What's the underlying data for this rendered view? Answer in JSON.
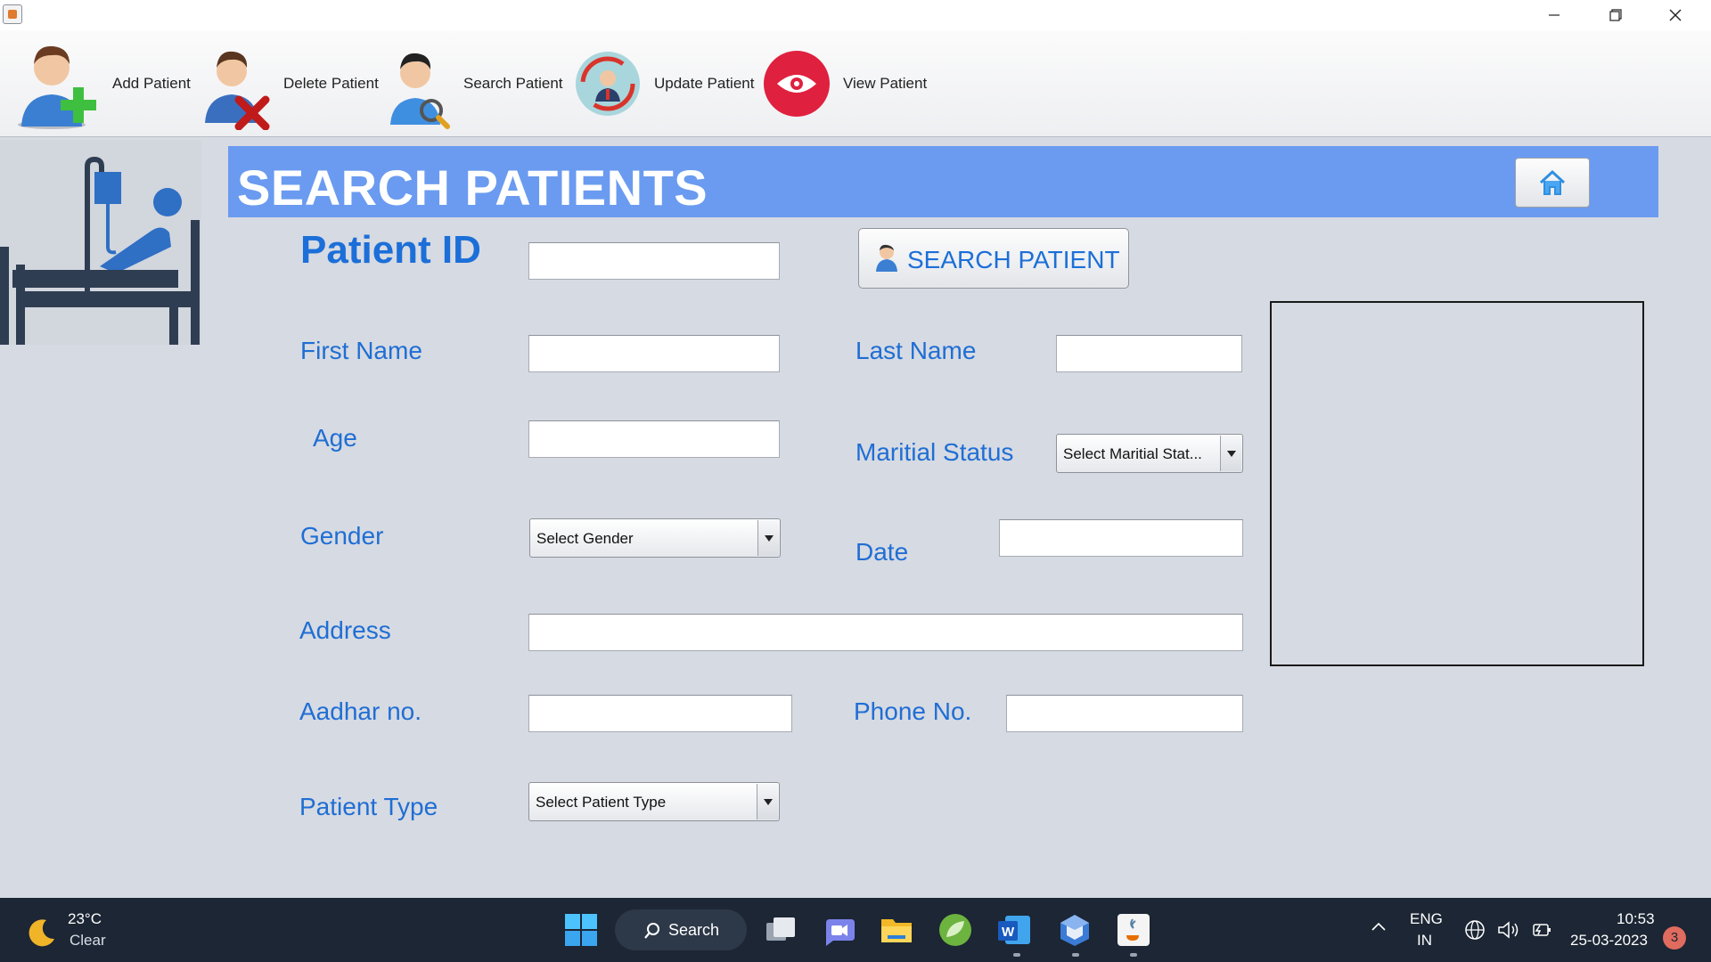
{
  "toolbar": {
    "items": [
      {
        "label": "Add Patient",
        "icon": "add-patient-icon"
      },
      {
        "label": "Delete Patient",
        "icon": "delete-patient-icon"
      },
      {
        "label": "Search Patient",
        "icon": "search-patient-icon"
      },
      {
        "label": "Update Patient",
        "icon": "update-patient-icon"
      },
      {
        "label": "View Patient",
        "icon": "view-patient-icon"
      }
    ]
  },
  "header": {
    "title": "SEARCH PATIENTS",
    "home_icon": "home-icon"
  },
  "form": {
    "patient_id": {
      "label": "Patient ID",
      "value": ""
    },
    "search_button": "SEARCH PATIENT",
    "first_name": {
      "label": "First Name",
      "value": ""
    },
    "last_name": {
      "label": "Last Name",
      "value": ""
    },
    "age": {
      "label": "Age",
      "value": ""
    },
    "marital_status": {
      "label": "Maritial Status",
      "selected": "Select Maritial Stat..."
    },
    "gender": {
      "label": "Gender",
      "selected": "Select Gender"
    },
    "date": {
      "label": "Date",
      "value": ""
    },
    "address": {
      "label": "Address",
      "value": ""
    },
    "aadhar": {
      "label": "Aadhar no.",
      "value": ""
    },
    "phone": {
      "label": "Phone No.",
      "value": ""
    },
    "patient_type": {
      "label": "Patient Type",
      "selected": "Select Patient Type"
    }
  },
  "taskbar": {
    "weather_temp": "23°C",
    "weather_condition": "Clear",
    "search_label": "Search",
    "lang_line1": "ENG",
    "lang_line2": "IN",
    "time": "10:53",
    "date": "25-03-2023",
    "notification_count": "3"
  },
  "colors": {
    "header_band": "#6a9bf0",
    "label_blue": "#1f6ed4",
    "background": "#d6dae2",
    "taskbar": "#1c2634"
  }
}
